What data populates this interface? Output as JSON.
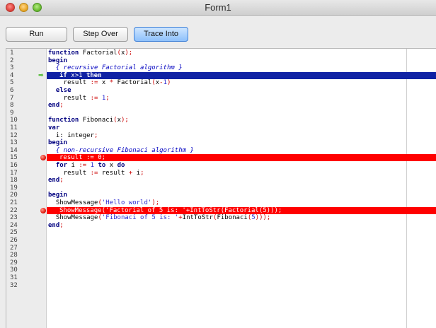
{
  "window": {
    "title": "Form1"
  },
  "toolbar": {
    "run_label": "Run",
    "step_label": "Step Over",
    "trace_label": "Trace Into"
  },
  "editor": {
    "lines": [
      {
        "n": "1",
        "state": "normal",
        "tokens": [
          [
            "kw",
            "function"
          ],
          [
            "id",
            " Factorial"
          ],
          [
            "sym",
            "("
          ],
          [
            "id",
            "x"
          ],
          [
            "sym",
            ");"
          ]
        ]
      },
      {
        "n": "2",
        "state": "normal",
        "tokens": [
          [
            "kw",
            "begin"
          ]
        ]
      },
      {
        "n": "3",
        "state": "normal",
        "tokens": [
          [
            "cm",
            "  { recursive Factorial algorithm }"
          ]
        ]
      },
      {
        "n": "4",
        "state": "exec",
        "tokens": [
          [
            "kw",
            "if "
          ],
          [
            "id",
            "x"
          ],
          [
            "sym",
            ">"
          ],
          [
            "num-lit",
            "1"
          ],
          [
            "kw",
            " then"
          ]
        ]
      },
      {
        "n": "5",
        "state": "normal",
        "tokens": [
          [
            "id",
            "    result "
          ],
          [
            "sym",
            ":="
          ],
          [
            "id",
            " x "
          ],
          [
            "sym",
            "*"
          ],
          [
            "id",
            " Factorial"
          ],
          [
            "sym",
            "("
          ],
          [
            "id",
            "x"
          ],
          [
            "sym",
            "-"
          ],
          [
            "num-lit",
            "1"
          ],
          [
            "sym",
            ")"
          ]
        ]
      },
      {
        "n": "6",
        "state": "normal",
        "tokens": [
          [
            "kw",
            "  else"
          ]
        ]
      },
      {
        "n": "7",
        "state": "normal",
        "tokens": [
          [
            "id",
            "    result "
          ],
          [
            "sym",
            ":="
          ],
          [
            "num-lit",
            " 1"
          ],
          [
            "sym",
            ";"
          ]
        ]
      },
      {
        "n": "8",
        "state": "normal",
        "tokens": [
          [
            "kw",
            "end"
          ],
          [
            "sym",
            ";"
          ]
        ]
      },
      {
        "n": "9",
        "state": "normal",
        "tokens": []
      },
      {
        "n": "10",
        "state": "normal",
        "tokens": [
          [
            "kw",
            "function"
          ],
          [
            "id",
            " Fibonaci"
          ],
          [
            "sym",
            "("
          ],
          [
            "id",
            "x"
          ],
          [
            "sym",
            ");"
          ]
        ]
      },
      {
        "n": "11",
        "state": "normal",
        "tokens": [
          [
            "kw",
            "var"
          ]
        ]
      },
      {
        "n": "12",
        "state": "normal",
        "tokens": [
          [
            "id",
            "  i: integer"
          ],
          [
            "sym",
            ";"
          ]
        ]
      },
      {
        "n": "13",
        "state": "normal",
        "tokens": [
          [
            "kw",
            "begin"
          ]
        ]
      },
      {
        "n": "14",
        "state": "normal",
        "tokens": [
          [
            "cm",
            "  { non-recursive Fibonaci algorithm }"
          ]
        ]
      },
      {
        "n": "15",
        "state": "brk",
        "tokens": [
          [
            "id",
            "result "
          ],
          [
            "sym",
            ":="
          ],
          [
            "num-lit",
            " 0"
          ],
          [
            "sym",
            ";"
          ]
        ]
      },
      {
        "n": "16",
        "state": "normal",
        "tokens": [
          [
            "kw",
            "  for"
          ],
          [
            "id",
            " i "
          ],
          [
            "sym",
            ":="
          ],
          [
            "num-lit",
            " 1"
          ],
          [
            "kw",
            " to"
          ],
          [
            "id",
            " x "
          ],
          [
            "kw",
            "do"
          ]
        ]
      },
      {
        "n": "17",
        "state": "normal",
        "tokens": [
          [
            "id",
            "    result "
          ],
          [
            "sym",
            ":="
          ],
          [
            "id",
            " result "
          ],
          [
            "sym",
            "+"
          ],
          [
            "id",
            " i"
          ],
          [
            "sym",
            ";"
          ]
        ]
      },
      {
        "n": "18",
        "state": "normal",
        "tokens": [
          [
            "kw",
            "end"
          ],
          [
            "sym",
            ";"
          ]
        ]
      },
      {
        "n": "19",
        "state": "normal",
        "tokens": []
      },
      {
        "n": "20",
        "state": "normal",
        "tokens": [
          [
            "kw",
            "begin"
          ]
        ]
      },
      {
        "n": "21",
        "state": "normal",
        "tokens": [
          [
            "id",
            "  ShowMessage"
          ],
          [
            "sym",
            "("
          ],
          [
            "str",
            "'Hello world'"
          ],
          [
            "sym",
            ");"
          ]
        ]
      },
      {
        "n": "22",
        "state": "brk",
        "tokens": [
          [
            "id",
            "ShowMessage"
          ],
          [
            "sym",
            "("
          ],
          [
            "str",
            "'Factorial of 5 is: '"
          ],
          [
            "sym",
            "+"
          ],
          [
            "id",
            "IntToStr"
          ],
          [
            "sym",
            "("
          ],
          [
            "id",
            "Factorial"
          ],
          [
            "sym",
            "("
          ],
          [
            "num-lit",
            "5"
          ],
          [
            "sym",
            ")));"
          ]
        ]
      },
      {
        "n": "23",
        "state": "normal",
        "tokens": [
          [
            "id",
            "  ShowMessage"
          ],
          [
            "sym",
            "("
          ],
          [
            "str",
            "'Fibonaci of 5 is: '"
          ],
          [
            "sym",
            "+"
          ],
          [
            "id",
            "IntToStr"
          ],
          [
            "sym",
            "("
          ],
          [
            "id",
            "Fibonaci"
          ],
          [
            "sym",
            "("
          ],
          [
            "num-lit",
            "5"
          ],
          [
            "sym",
            ")));"
          ]
        ]
      },
      {
        "n": "24",
        "state": "normal",
        "tokens": [
          [
            "kw",
            "end"
          ],
          [
            "sym",
            ";"
          ]
        ]
      },
      {
        "n": "25",
        "state": "normal",
        "tokens": []
      },
      {
        "n": "26",
        "state": "normal",
        "tokens": []
      },
      {
        "n": "27",
        "state": "normal",
        "tokens": []
      },
      {
        "n": "28",
        "state": "normal",
        "tokens": []
      },
      {
        "n": "29",
        "state": "normal",
        "tokens": []
      },
      {
        "n": "30",
        "state": "normal",
        "tokens": []
      },
      {
        "n": "31",
        "state": "normal",
        "tokens": []
      },
      {
        "n": "32",
        "state": "normal",
        "tokens": []
      }
    ]
  },
  "colors": {
    "exec_highlight": "#1022a4",
    "breakpoint_highlight": "#ff0000",
    "keyword": "#000080",
    "comment": "#0000c0"
  },
  "icons": {
    "exec_marker": "execution-arrow-icon",
    "breakpoint_marker": "breakpoint-dot-icon"
  }
}
